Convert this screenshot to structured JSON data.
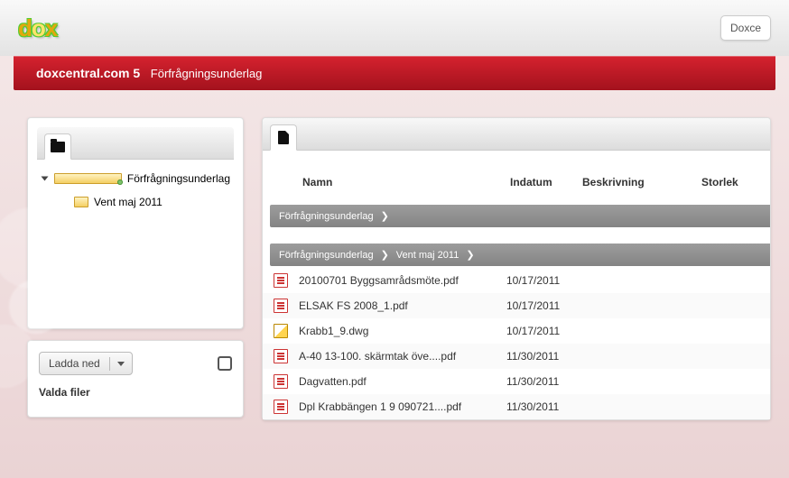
{
  "topbar": {
    "logo_d": "d",
    "logo_o": "o",
    "logo_x": "x",
    "right_btn": "Doxce"
  },
  "redbar": {
    "site": "doxcentral.com 5",
    "crumb": "Förfrågningsunderlag"
  },
  "tree": {
    "root": "Förfrågningsunderlag",
    "child": "Vent maj 2011"
  },
  "download": {
    "label": "Ladda ned",
    "selected_label": "Valda filer"
  },
  "columns": {
    "name": "Namn",
    "indatum": "Indatum",
    "desc": "Beskrivning",
    "size": "Storlek"
  },
  "crumb1": [
    "Förfrågningsunderlag"
  ],
  "crumb2": [
    "Förfrågningsunderlag",
    "Vent maj 2011"
  ],
  "files": [
    {
      "icon": "pdf",
      "name": "20100701 Byggsamrådsmöte.pdf",
      "date": "10/17/2011"
    },
    {
      "icon": "pdf",
      "name": "ELSAK FS 2008_1.pdf",
      "date": "10/17/2011"
    },
    {
      "icon": "dwg",
      "name": "Krabb1_9.dwg",
      "date": "10/17/2011"
    },
    {
      "icon": "pdf",
      "name": "A-40 13-100. skärmtak öve....pdf",
      "date": "11/30/2011"
    },
    {
      "icon": "pdf",
      "name": "Dagvatten.pdf",
      "date": "11/30/2011"
    },
    {
      "icon": "pdf",
      "name": "Dpl Krabbängen 1 9 090721....pdf",
      "date": "11/30/2011"
    }
  ]
}
